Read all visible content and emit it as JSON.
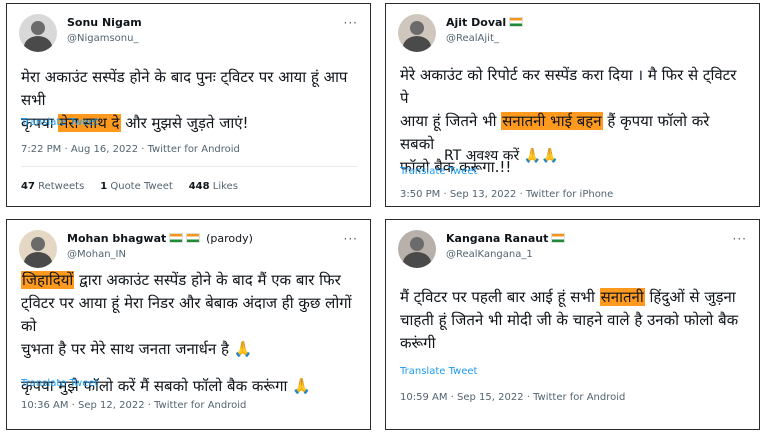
{
  "tweets": [
    {
      "name": "Sonu Nigam",
      "handle": "@Nigamsonu_",
      "line1": "मेरा अकाउंट सस्पेंड होने के बाद पुनः ट्विटर पर आया हूं आप सभी",
      "line2_pre": "कृपया ",
      "line2_hl": "मेरा साथ दे",
      "line2_post": " और मुझसे जुड़ते जाएं!",
      "translate": "Translate Tweet",
      "meta": "7:22 PM · Aug 16, 2022 · Twitter for Android",
      "retweets": "47",
      "retweets_label": "Retweets",
      "quotes": "1",
      "quotes_label": "Quote Tweet",
      "likes": "448",
      "likes_label": "Likes"
    },
    {
      "name": "Ajit Doval",
      "handle": "@RealAjit_",
      "line1": "मेरे अकाउंट को रिपोर्ट कर सस्पेंड करा दिया । मै फिर से ट्विटर पे",
      "line2_pre": "आया हूं जितने भी ",
      "line2_hl": "सनातनी भाई बहन",
      "line2_post": " हैं कृपया फॉलो करे सबको",
      "line3": "फॉलो बैक करूंगा.!!",
      "extra": "RT अवश्य करें 🙏🙏",
      "translate": "Translate Tweet",
      "meta": "3:50 PM · Sep 13, 2022 · Twitter for iPhone"
    },
    {
      "name": "Mohan bhagwat",
      "parody": "(parody)",
      "handle": "@Mohan_IN",
      "line1_hl": "जिहादियों",
      "line1_post": " द्वारा अकाउंट सस्पेंड होने के बाद मैं एक बार फिर",
      "line2": "ट्विटर पर आया हूं मेरा निडर और बेबाक अंदाज ही कुछ लोगों को",
      "line3": "चुभता है पर मेरे साथ जनता जनार्धन है 🙏",
      "line4": "कृपया मुझे फॉलो करें मैं सबको फॉलो बैक करूंगा 🙏",
      "translate": "Translate Tweet",
      "meta": "10:36 AM · Sep 12, 2022 · Twitter for Android"
    },
    {
      "name": "Kangana Ranaut",
      "handle": "@RealKangana_1",
      "line1_pre": "मैं ट्विटर पर पहली बार आई हूं सभी ",
      "line1_hl": "सनातनी",
      "line1_post": " हिंदुओं से जुड़ना",
      "line2": "चाहती हूं जितने भी मोदी जी के चाहने वाले है उनको फोलो बैक",
      "line3": "करूंगी",
      "translate": "Translate Tweet",
      "meta": "10:59 AM · Sep 15, 2022 · Twitter for Android"
    }
  ],
  "more_icon": "···",
  "colors": {
    "highlight": "#ff9a1f",
    "link": "#1d9bf0",
    "muted": "#536471"
  }
}
